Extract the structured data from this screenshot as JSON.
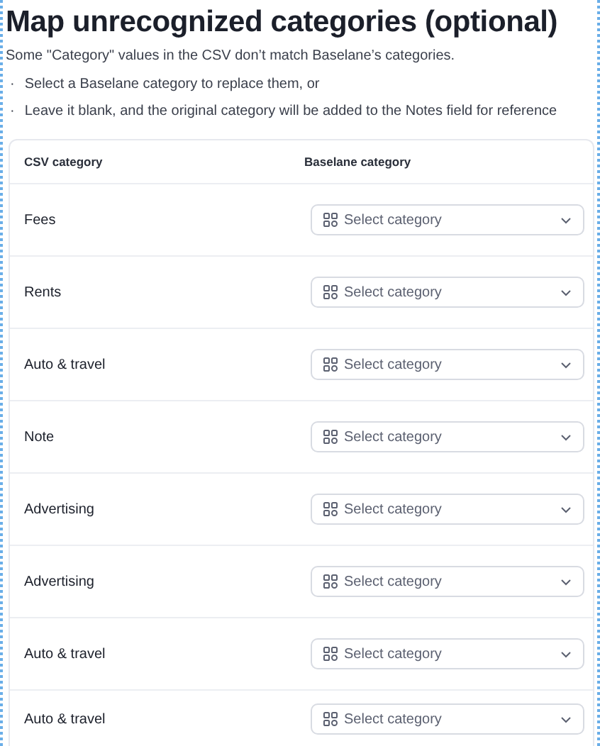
{
  "title": "Map unrecognized categories (optional)",
  "description": "Some \"Category\" values in the CSV don’t match Baselane’s categories.",
  "bullets": [
    {
      "marker": "·",
      "text": "Select a Baselane category to replace them, or"
    },
    {
      "marker": "·",
      "text": "Leave it blank, and the original category will be added to the Notes field for reference"
    }
  ],
  "table": {
    "columns": [
      "CSV category",
      "Baselane category"
    ],
    "rows": [
      {
        "csv_category": "Fees",
        "placeholder": "Select category"
      },
      {
        "csv_category": "Rents",
        "placeholder": "Select category"
      },
      {
        "csv_category": "Auto & travel",
        "placeholder": "Select category"
      },
      {
        "csv_category": "Note",
        "placeholder": "Select category"
      },
      {
        "csv_category": "Advertising",
        "placeholder": "Select category"
      },
      {
        "csv_category": "Advertising",
        "placeholder": "Select category"
      },
      {
        "csv_category": "Auto & travel",
        "placeholder": "Select category"
      },
      {
        "csv_category": "Auto & travel",
        "placeholder": "Select category"
      }
    ]
  }
}
